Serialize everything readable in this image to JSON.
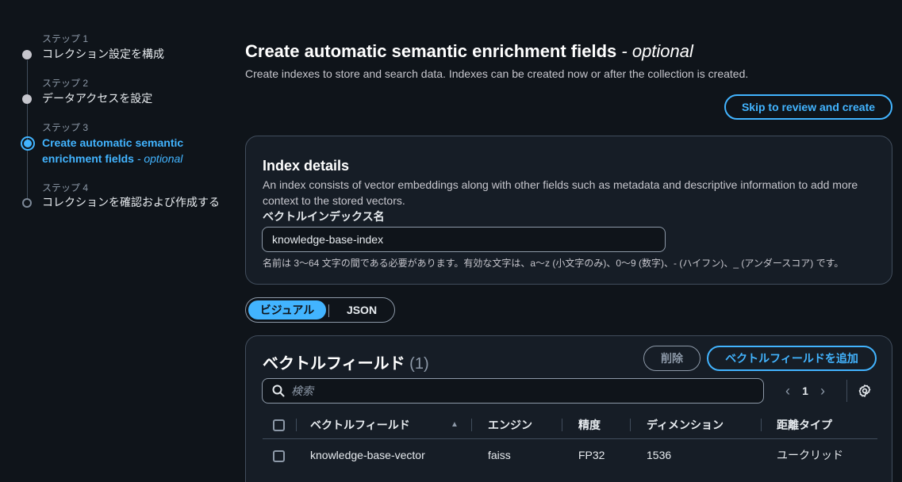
{
  "steps": [
    {
      "small": "ステップ 1",
      "label": "コレクション設定を構成",
      "state": "done"
    },
    {
      "small": "ステップ 2",
      "label": "データアクセスを設定",
      "state": "done"
    },
    {
      "small": "ステップ 3",
      "label_line1": "Create automatic semantic",
      "label_line2": "enrichment fields",
      "optional": "- optional",
      "state": "active"
    },
    {
      "small": "ステップ 4",
      "label": "コレクションを確認および作成する",
      "state": "future"
    }
  ],
  "header": {
    "title": "Create automatic semantic enrichment fields",
    "title_optional": "- optional",
    "description": "Create indexes to store and search data. Indexes can be created now or after the collection is created.",
    "skip_button": "Skip to review and create"
  },
  "index_details": {
    "title": "Index details",
    "description": "An index consists of vector embeddings along with other fields such as metadata and descriptive information to add more context to the stored vectors.",
    "name_label": "ベクトルインデックス名",
    "name_value": "knowledge-base-index",
    "name_hint": "名前は 3〜64 文字の間である必要があります。有効な文字は、a〜z (小文字のみ)、0〜9 (数字)、- (ハイフン)、_ (アンダースコア) です。"
  },
  "segmented": {
    "options": [
      "ビジュアル",
      "JSON"
    ],
    "selected": "ビジュアル"
  },
  "vector_fields": {
    "title": "ベクトルフィールド",
    "count": "(1)",
    "delete_button": "削除",
    "add_button": "ベクトルフィールドを追加",
    "search_placeholder": "検索",
    "page": "1",
    "columns": [
      "ベクトルフィールド",
      "エンジン",
      "精度",
      "ディメンション",
      "距離タイプ"
    ],
    "rows": [
      {
        "field": "knowledge-base-vector",
        "engine": "faiss",
        "precision": "FP32",
        "dimension": "1536",
        "distance": "ユークリッド"
      }
    ]
  },
  "colors": {
    "accent": "#42b4ff",
    "background": "#0f141a",
    "card": "#161d26"
  }
}
